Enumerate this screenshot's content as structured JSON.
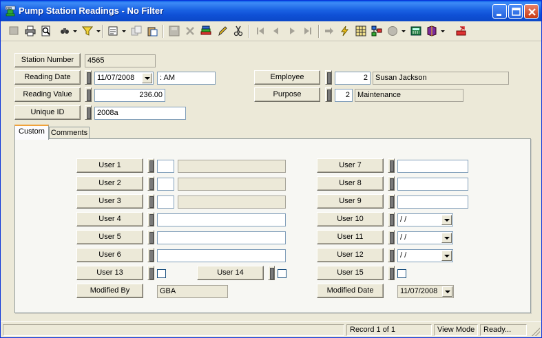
{
  "window": {
    "title": "Pump Station Readings - No Filter"
  },
  "header": {
    "station_number_label": "Station Number",
    "station_number_value": "4565",
    "reading_date_label": "Reading Date",
    "reading_date_value": "11/07/2008",
    "reading_time_value": " :  AM",
    "reading_value_label": "Reading Value",
    "reading_value_value": "236.00",
    "unique_id_label": "Unique ID",
    "unique_id_value": "2008a",
    "employee_label": "Employee",
    "employee_id": "2",
    "employee_name": "Susan Jackson",
    "purpose_label": "Purpose",
    "purpose_id": "2",
    "purpose_name": "Maintenance"
  },
  "tabs": [
    {
      "label": "Custom",
      "active": true
    },
    {
      "label": "Comments",
      "active": false
    }
  ],
  "custom": {
    "user1_label": "User 1",
    "user2_label": "User 2",
    "user3_label": "User 3",
    "user4_label": "User 4",
    "user5_label": "User 5",
    "user6_label": "User 6",
    "user7_label": "User 7",
    "user8_label": "User 8",
    "user9_label": "User 9",
    "user10_label": "User 10",
    "user10_value": " / /",
    "user11_label": "User 11",
    "user11_value": " / /",
    "user12_label": "User 12",
    "user12_value": " / /",
    "user13_label": "User 13",
    "user14_label": "User 14",
    "user15_label": "User 15",
    "modified_by_label": "Modified By",
    "modified_by_value": "GBA",
    "modified_date_label": "Modified Date",
    "modified_date_value": "11/07/2008"
  },
  "statusbar": {
    "record": "Record 1 of 1",
    "mode": "View Mode",
    "state": "Ready..."
  },
  "colors": {
    "titlebar": "#0b48c8",
    "window_bg": "#ece9d8",
    "tab_accent": "#f0a23a"
  },
  "toolbar_icons": [
    "new-icon",
    "print-icon",
    "print-preview-icon",
    "find-icon",
    "filter-icon",
    "form-icon",
    "copy-icon",
    "paste-icon",
    "save-icon",
    "delete-icon",
    "books-icon",
    "pencil-icon",
    "scissors-icon",
    "first-record-icon",
    "previous-record-icon",
    "next-record-icon",
    "last-record-icon",
    "go-to-icon",
    "lightning-icon",
    "grid-icon",
    "hierarchy-icon",
    "globe-icon",
    "calculator-icon",
    "book-icon",
    "exit-icon"
  ]
}
